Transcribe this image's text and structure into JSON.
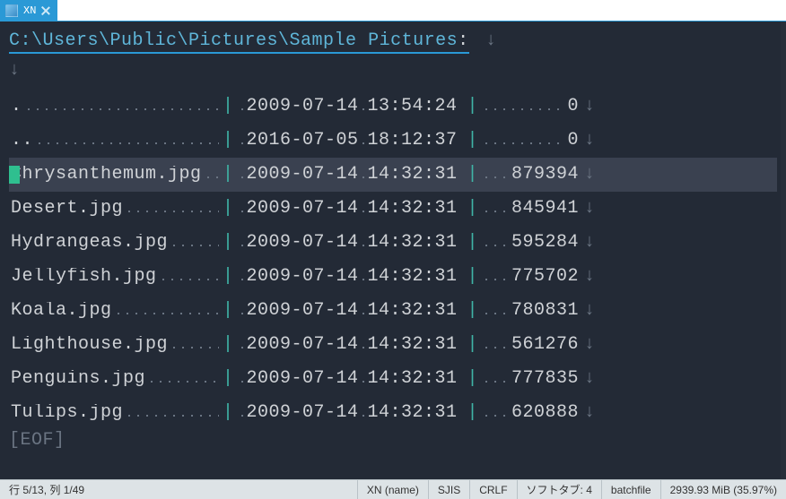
{
  "window": {
    "tab_title": "XN"
  },
  "path": "C:\\Users\\Public\\Pictures\\Sample Pictures",
  "path_suffix": ":",
  "eof_label": "[EOF]",
  "files": [
    {
      "name": ".",
      "date": "2009-07-14",
      "time": "13:54:24",
      "size": "0"
    },
    {
      "name": "..",
      "date": "2016-07-05",
      "time": "18:12:37",
      "size": "0"
    },
    {
      "name": "Chrysanthemum.jpg",
      "date": "2009-07-14",
      "time": "14:32:31",
      "size": "879394",
      "selected": true
    },
    {
      "name": "Desert.jpg",
      "date": "2009-07-14",
      "time": "14:32:31",
      "size": "845941"
    },
    {
      "name": "Hydrangeas.jpg",
      "date": "2009-07-14",
      "time": "14:32:31",
      "size": "595284"
    },
    {
      "name": "Jellyfish.jpg",
      "date": "2009-07-14",
      "time": "14:32:31",
      "size": "775702"
    },
    {
      "name": "Koala.jpg",
      "date": "2009-07-14",
      "time": "14:32:31",
      "size": "780831"
    },
    {
      "name": "Lighthouse.jpg",
      "date": "2009-07-14",
      "time": "14:32:31",
      "size": "561276"
    },
    {
      "name": "Penguins.jpg",
      "date": "2009-07-14",
      "time": "14:32:31",
      "size": "777835"
    },
    {
      "name": "Tulips.jpg",
      "date": "2009-07-14",
      "time": "14:32:31",
      "size": "620888"
    }
  ],
  "status": {
    "cursor": "行 5/13, 列 1/49",
    "mode": "XN (name)",
    "encoding": "SJIS",
    "lineend": "CRLF",
    "softtab": "ソフトタブ: 4",
    "filetype": "batchfile",
    "memory": "2939.93 MiB (35.97%)"
  }
}
